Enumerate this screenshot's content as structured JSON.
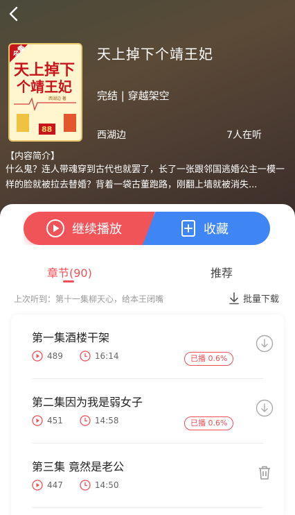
{
  "book": {
    "title": "天上掉下个靖王妃",
    "meta": "完结 | 穿越架空",
    "author": "西湖边",
    "listeners": "7人在听",
    "intro_label": "【内容简介】",
    "intro_text": "什么鬼？连人带魂穿到古代也就罢了，长了一张跟邻国逃婚公主一模一样的脸就被拉去替婚？背着一袋古董跑路，刚翻上墙就被消失...",
    "cover": {
      "title_text": "天上掉下个靖王妃",
      "tag": "全集",
      "small_text": "西湖边 著",
      "number": "88"
    }
  },
  "actions": {
    "play_label": "继续播放",
    "favorite_label": "收藏"
  },
  "tabs": {
    "chapters_label": "章节(90)",
    "recommend_label": "推荐"
  },
  "last_listened": "上次听到：第十一集柳天心，给本王闭嘴",
  "batch_download_label": "批量下载",
  "episodes": [
    {
      "title": "第一集酒楼干架",
      "plays": "489",
      "duration": "16:14",
      "progress": "已播 0.6%",
      "action_icon": "download-icon"
    },
    {
      "title": "第二集因为我是弱女子",
      "plays": "451",
      "duration": "14:58",
      "progress": "已播 0.6%",
      "action_icon": "download-icon"
    },
    {
      "title": "第三集 竟然是老公",
      "plays": "447",
      "duration": "14:50",
      "progress": "",
      "action_icon": "trash-icon"
    }
  ],
  "colors": {
    "accent_red": "#ef4f55",
    "accent_blue": "#3f86f4"
  }
}
